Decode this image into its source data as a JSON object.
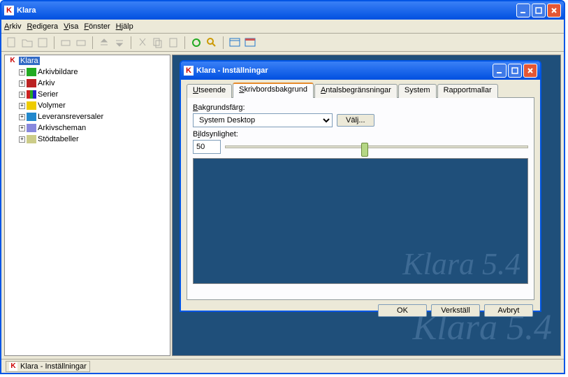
{
  "window": {
    "title": "Klara"
  },
  "menu": {
    "arkiv": "Arkiv",
    "redigera": "Redigera",
    "visa": "Visa",
    "fonster": "Fönster",
    "hjalp": "Hjälp"
  },
  "tree": {
    "root": "Klara",
    "items": [
      "Arkivbildare",
      "Arkiv",
      "Serier",
      "Volymer",
      "Leveransreversaler",
      "Arkivscheman",
      "Stödtabeller"
    ]
  },
  "content": {
    "watermark": "Klara 5.4"
  },
  "dialog": {
    "title": "Klara - Inställningar",
    "tabs": [
      "Utseende",
      "Skrivbordsbakgrund",
      "Antalsbegränsningar",
      "System",
      "Rapportmallar"
    ],
    "active_tab": 1,
    "bg_label": "Bakgrundsfärg:",
    "bg_value": "System Desktop",
    "choose_btn": "Välj...",
    "vis_label": "Bildsynlighet:",
    "vis_value": "50",
    "preview_watermark": "Klara 5.4",
    "ok": "OK",
    "apply": "Verkställ",
    "cancel": "Avbryt"
  },
  "status": {
    "text": "Klara - Inställningar"
  }
}
